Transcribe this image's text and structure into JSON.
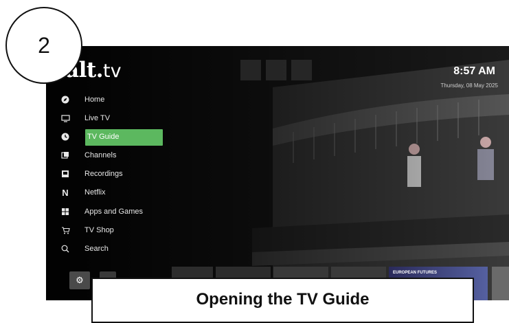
{
  "brand": {
    "name": "alt",
    "separator": ".",
    "suffix": "tv"
  },
  "status": {
    "time": "8:57 AM",
    "date": "Thursday, 08 May 2025"
  },
  "menu": {
    "items": [
      {
        "label": "Home",
        "icon": "compass-icon"
      },
      {
        "label": "Live TV",
        "icon": "monitor-icon"
      },
      {
        "label": "TV Guide",
        "icon": "clock-icon",
        "active": true
      },
      {
        "label": "Channels",
        "icon": "channels-icon"
      },
      {
        "label": "Recordings",
        "icon": "recordings-icon"
      },
      {
        "label": "Netflix",
        "icon": "netflix-icon"
      },
      {
        "label": "Apps and Games",
        "icon": "grid-icon"
      },
      {
        "label": "TV Shop",
        "icon": "cart-icon"
      },
      {
        "label": "Search",
        "icon": "search-icon"
      }
    ]
  },
  "promo": {
    "label": "EUROPEAN FUTURES"
  },
  "tutorial": {
    "step": "2",
    "caption": "Opening the TV Guide"
  },
  "colors": {
    "active_highlight": "#5cb85f",
    "background": "#0b0b0b"
  }
}
